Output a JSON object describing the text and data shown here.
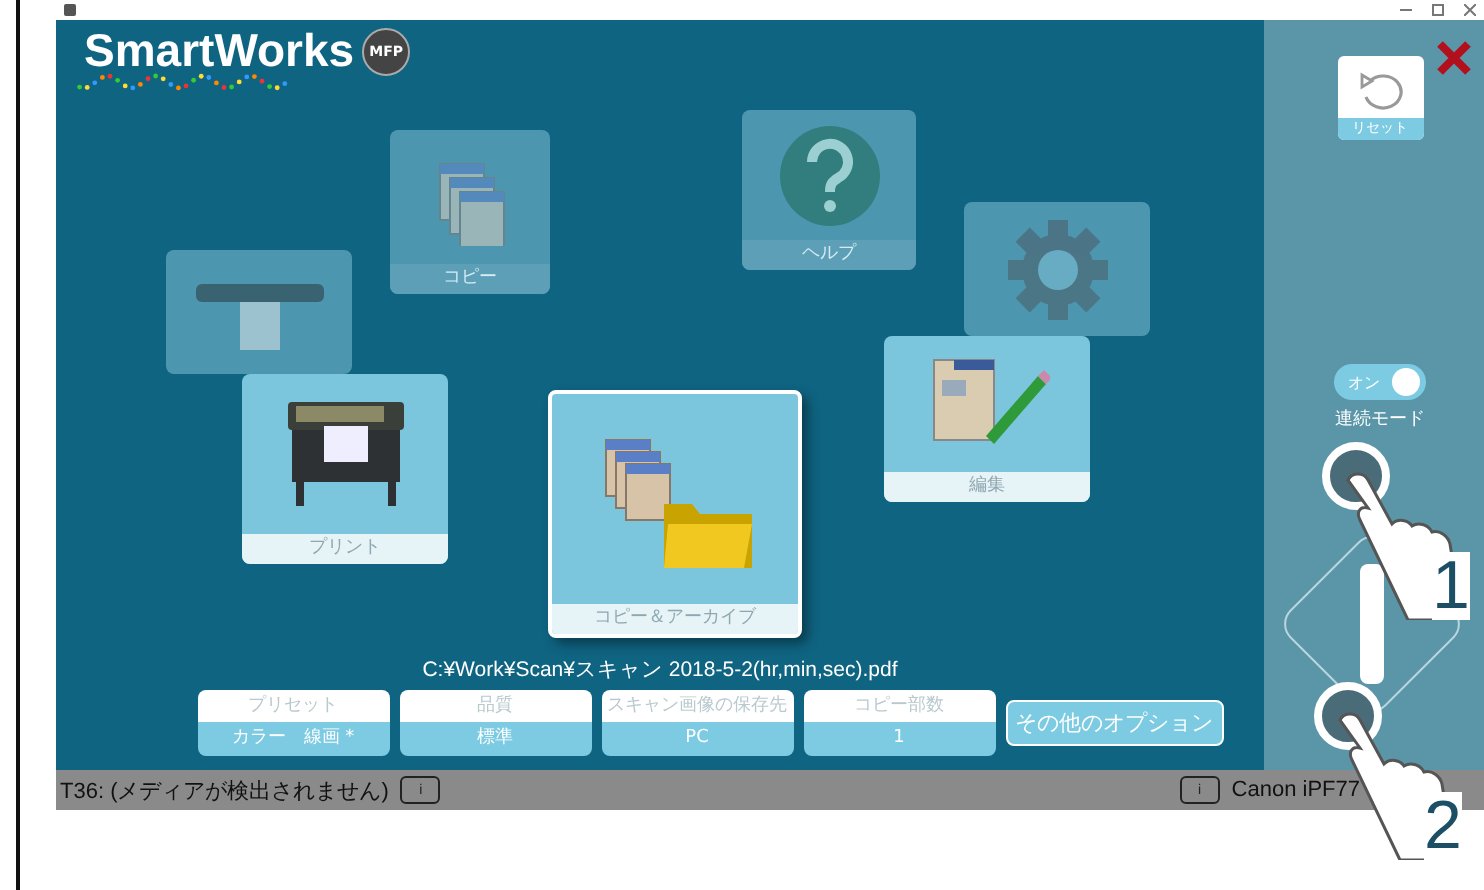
{
  "logo": {
    "text": "SmartWorks",
    "badge": "MFP"
  },
  "tiles": [
    {
      "kind": "scanner",
      "disabled": true
    },
    {
      "kind": "copy",
      "label": "コピー",
      "disabled": true
    },
    {
      "kind": "help",
      "label": "ヘルプ",
      "disabled": true
    },
    {
      "kind": "settings",
      "disabled": true
    },
    {
      "kind": "printer",
      "label": "プリント",
      "disabled": false
    },
    {
      "kind": "archive",
      "label": "コピー＆アーカイブ",
      "disabled": false,
      "selected": true
    },
    {
      "kind": "edit",
      "label": "編集",
      "disabled": false
    }
  ],
  "output_path": "C:¥Work¥Scan¥スキャン 2018-5-2(hr,min,sec).pdf",
  "settings": [
    {
      "label": "プリセット",
      "value": "カラー　線画 *"
    },
    {
      "label": "品質",
      "value": "標準"
    },
    {
      "label": "スキャン画像の保存先",
      "value": "PC"
    },
    {
      "label": "コピー部数",
      "value": "1"
    }
  ],
  "more_options": "その他のオプション",
  "side_panel": {
    "reset": "リセット",
    "toggle": {
      "label": "オン",
      "on": true
    },
    "mode_label": "連続モード"
  },
  "status_bar": {
    "left": "T36: (メディアが検出されません)",
    "left_info": "i",
    "right_info": "i",
    "right": "Canon iPF77"
  },
  "callouts": [
    "1",
    "2"
  ]
}
